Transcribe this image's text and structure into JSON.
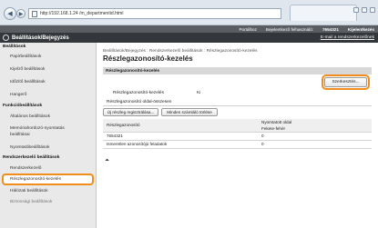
{
  "browser": {
    "url": "http://192.168.1.24 /m_departmentid.html"
  },
  "topbar": {
    "portal": "Portálhoz",
    "login_label": "Bejelentkező felhasználó:",
    "login_value": "7654321",
    "logout": "Kijelentkezés"
  },
  "header": {
    "title": "Beállítások/Bejegyzés",
    "mail": "E-mail a rendszerkezelőnek"
  },
  "sidebar": {
    "items": [
      {
        "label": "Beállítások",
        "type": "head"
      },
      {
        "label": "Papírbeállítások",
        "type": "item"
      },
      {
        "label": "Kijelző beállítások",
        "type": "item"
      },
      {
        "label": "Időzítő beállítások",
        "type": "item"
      },
      {
        "label": "Hangerő",
        "type": "item"
      },
      {
        "label": "Funkcióbeállítások",
        "type": "head"
      },
      {
        "label": "Általános beállítások",
        "type": "item"
      },
      {
        "label": "Memóriahordozó-nyomtatás beállításai",
        "type": "item"
      },
      {
        "label": "Nyomtatóbeállítások",
        "type": "item"
      },
      {
        "label": "Rendszerkezelő beállítások",
        "type": "head"
      },
      {
        "label": "Rendszerkezelő",
        "type": "item"
      },
      {
        "label": "Részlegazonosító-kezelés",
        "type": "item",
        "active": true
      },
      {
        "label": "Hálózati beállítások",
        "type": "item"
      },
      {
        "label": "Biztonsági beállítások",
        "type": "item"
      }
    ]
  },
  "main": {
    "breadcrumb": "Beállítások/Bejegyzés : Rendszerkezelő beállítások : Részlegazonosító-kezelés",
    "title": "Részlegazonosító-kezelés",
    "section_label": "Részlegazonosító-kezelés",
    "settings_button": "Szerkesztés...",
    "field_label": "Részlegazonosító-kezelés",
    "field_value": "Ki",
    "sub_title": "Részlegazonosító oldal-összesen",
    "register_button": "Új részleg regisztrálása...",
    "clear_button": "Minden számláló törlése",
    "table": {
      "col1_header": "Részlegazonosító",
      "col2_header_top": "Nyomtatott oldal",
      "col2_header_bottom": "Fekete-fehér",
      "rows": [
        {
          "id": "7654321",
          "count": "0"
        },
        {
          "id": "Ismeretlen azonosítójú feladatok",
          "count": "0"
        }
      ]
    }
  }
}
